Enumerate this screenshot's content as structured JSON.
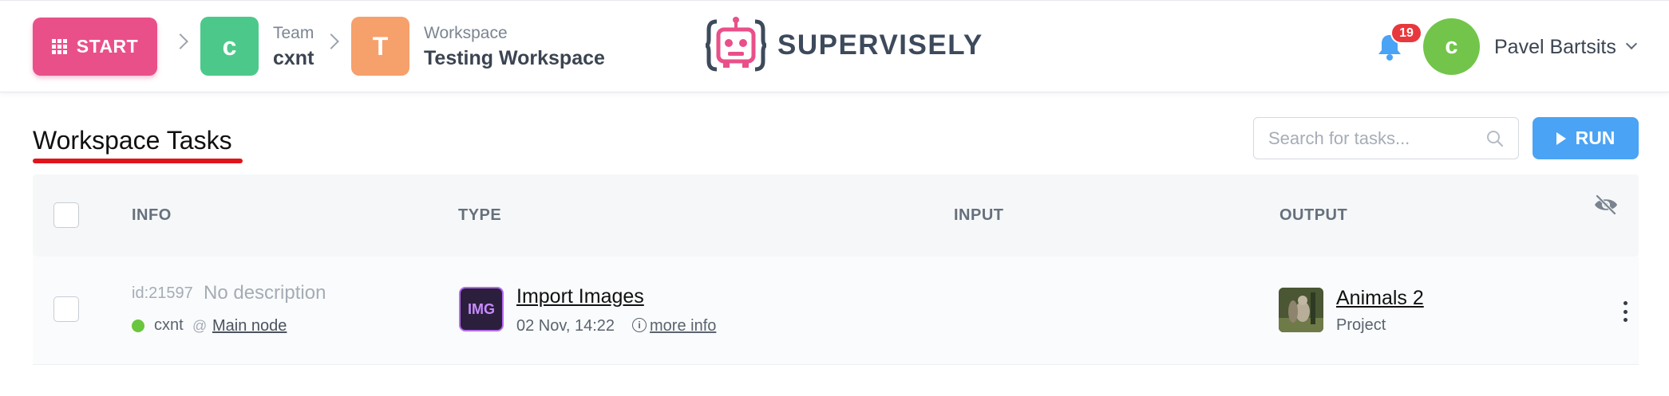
{
  "header": {
    "start_label": "START",
    "team": {
      "initial": "c",
      "label": "Team",
      "value": "cxnt"
    },
    "workspace": {
      "initial": "T",
      "label": "Workspace",
      "value": "Testing Workspace"
    },
    "logo_text": "SUPERVISELY",
    "notifications_count": "19",
    "user": {
      "initial": "c",
      "name": "Pavel Bartsits"
    },
    "colors": {
      "start": "#e9508a",
      "team_tile": "#4cc98a",
      "workspace_tile": "#f6a06c",
      "avatar": "#72c54a",
      "badge": "#e8383d",
      "bell": "#4aa3f4"
    }
  },
  "page": {
    "title": "Workspace Tasks",
    "search_placeholder": "Search for tasks...",
    "run_label": "RUN"
  },
  "table": {
    "columns": [
      "INFO",
      "TYPE",
      "INPUT",
      "OUTPUT"
    ],
    "rows": [
      {
        "id": "id:21597",
        "description": "No description",
        "team": "cxnt",
        "at": "@",
        "node": "Main node",
        "type_icon_text": "IMG",
        "type_name": "Import Images",
        "date": "02 Nov, 14:22",
        "more_info": "more info",
        "output_name": "Animals 2",
        "output_kind": "Project",
        "status_color": "#6ac63c"
      }
    ]
  }
}
